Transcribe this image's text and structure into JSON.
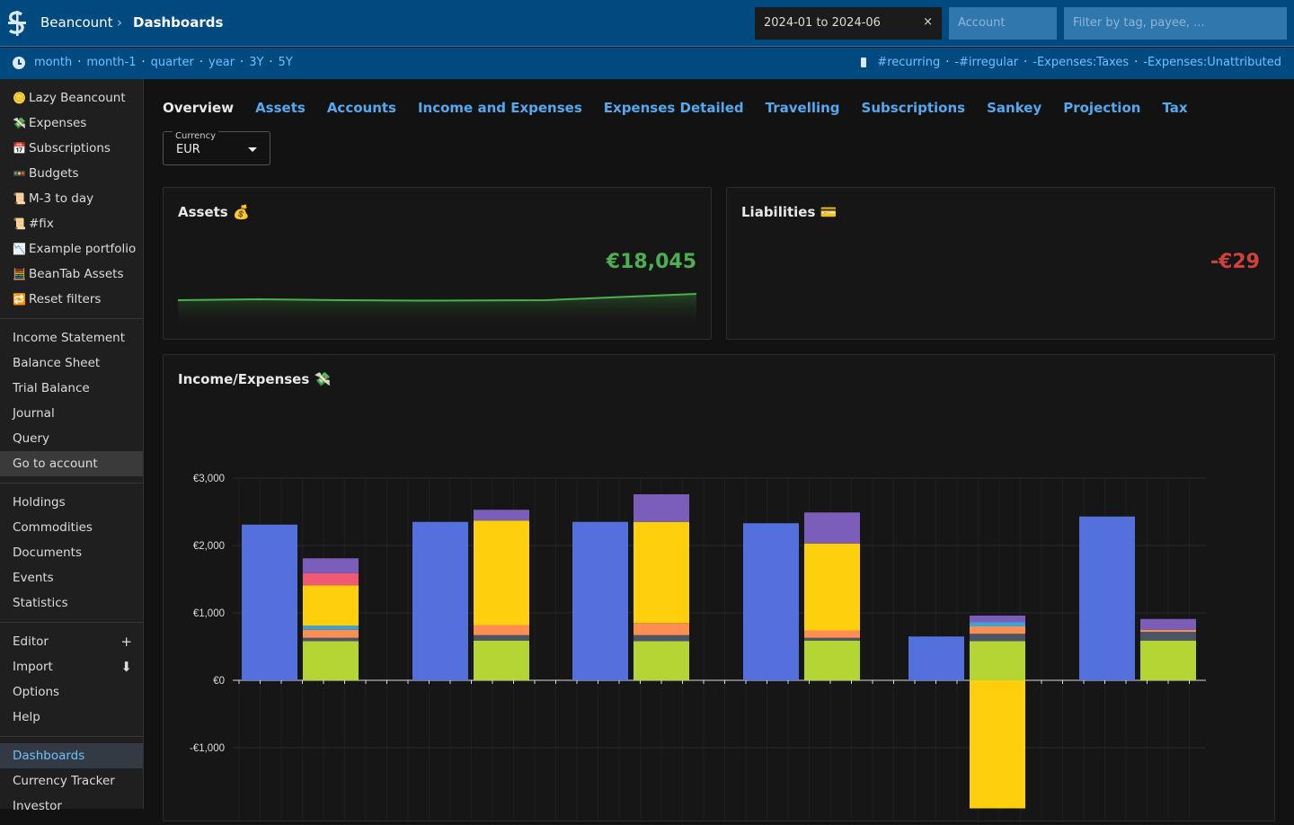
{
  "header": {
    "brand": "Beancount",
    "separator": "›",
    "page": "Dashboards",
    "date_filter": "2024-01 to 2024-06",
    "clear_symbol": "×",
    "account_placeholder": "Account",
    "tag_placeholder": "Filter by tag, payee, ..."
  },
  "time_links": [
    "month",
    "month-1",
    "quarter",
    "year",
    "3Y",
    "5Y"
  ],
  "tag_links": [
    "#recurring",
    "-#irregular",
    "-Expenses:Taxes",
    "-Expenses:Unattributed"
  ],
  "sidebar": {
    "group1": [
      {
        "icon": "🪙",
        "label": "Lazy Beancount"
      },
      {
        "icon": "💸",
        "label": "Expenses"
      },
      {
        "icon": "📅",
        "label": "Subscriptions"
      },
      {
        "icon": "🚥",
        "label": "Budgets"
      },
      {
        "icon": "📜",
        "label": "M-3 to day"
      },
      {
        "icon": "📜",
        "label": "#fix"
      },
      {
        "icon": "📉",
        "label": "Example portfolio"
      },
      {
        "icon": "🧮",
        "label": "BeanTab Assets"
      },
      {
        "icon": "🔁",
        "label": "Reset filters"
      }
    ],
    "group2": [
      "Income Statement",
      "Balance Sheet",
      "Trial Balance",
      "Journal",
      "Query",
      "Go to account"
    ],
    "group3": [
      "Holdings",
      "Commodities",
      "Documents",
      "Events",
      "Statistics"
    ],
    "group4": [
      {
        "label": "Editor",
        "extra": "+"
      },
      {
        "label": "Import",
        "extra": "⬇"
      },
      {
        "label": "Options",
        "extra": ""
      },
      {
        "label": "Help",
        "extra": ""
      }
    ],
    "group5": [
      "Dashboards",
      "Currency Tracker",
      "Investor"
    ]
  },
  "tabs": [
    "Overview",
    "Assets",
    "Accounts",
    "Income and Expenses",
    "Expenses Detailed",
    "Travelling",
    "Subscriptions",
    "Sankey",
    "Projection",
    "Tax"
  ],
  "currency": {
    "label": "Currency",
    "value": "EUR"
  },
  "cards": {
    "assets": {
      "title": "Assets 💰",
      "value": "€18,045"
    },
    "liabilities": {
      "title": "Liabilities 💳",
      "value": "-€29"
    },
    "income_expenses": {
      "title": "Income/Expenses 💸"
    }
  },
  "colors": {
    "income": "#5470dc",
    "lime": "#b5d534",
    "slate": "#4b5568",
    "orange": "#fc8e52",
    "cyan": "#3ba4d4",
    "yellow": "#fdcf0d",
    "pink": "#ee5a73",
    "purple": "#7b5dba"
  },
  "chart_data": {
    "type": "bar",
    "title": "Income/Expenses 💸",
    "yticks": [
      "€3,000",
      "€2,000",
      "€1,000",
      "€0",
      "-€1,000"
    ],
    "ylim": [
      -2000,
      3000
    ],
    "income": [
      2310,
      2350,
      2350,
      2330,
      650,
      2430
    ],
    "expenses": [
      [
        {
          "c": "lime",
          "v": 580
        },
        {
          "c": "slate",
          "v": 50
        },
        {
          "c": "orange",
          "v": 120
        },
        {
          "c": "cyan",
          "v": 60
        },
        {
          "c": "yellow",
          "v": 600
        },
        {
          "c": "pink",
          "v": 180
        },
        {
          "c": "purple",
          "v": 220
        }
      ],
      [
        {
          "c": "lime",
          "v": 590
        },
        {
          "c": "slate",
          "v": 80
        },
        {
          "c": "orange",
          "v": 150
        },
        {
          "c": "yellow",
          "v": 1550
        },
        {
          "c": "purple",
          "v": 160
        }
      ],
      [
        {
          "c": "lime",
          "v": 580
        },
        {
          "c": "slate",
          "v": 90
        },
        {
          "c": "orange",
          "v": 180
        },
        {
          "c": "yellow",
          "v": 1500
        },
        {
          "c": "purple",
          "v": 410
        }
      ],
      [
        {
          "c": "lime",
          "v": 590
        },
        {
          "c": "slate",
          "v": 40
        },
        {
          "c": "orange",
          "v": 110
        },
        {
          "c": "yellow",
          "v": 1290
        },
        {
          "c": "purple",
          "v": 460
        }
      ],
      [
        {
          "c": "lime",
          "v": 580
        },
        {
          "c": "slate",
          "v": 110
        },
        {
          "c": "orange",
          "v": 110
        },
        {
          "c": "cyan",
          "v": 60
        },
        {
          "c": "purple",
          "v": 100
        },
        {
          "c": "yellow",
          "v": -1900
        }
      ],
      [
        {
          "c": "lime",
          "v": 590
        },
        {
          "c": "slate",
          "v": 130
        },
        {
          "c": "orange",
          "v": 30
        },
        {
          "c": "purple",
          "v": 160
        }
      ]
    ]
  }
}
